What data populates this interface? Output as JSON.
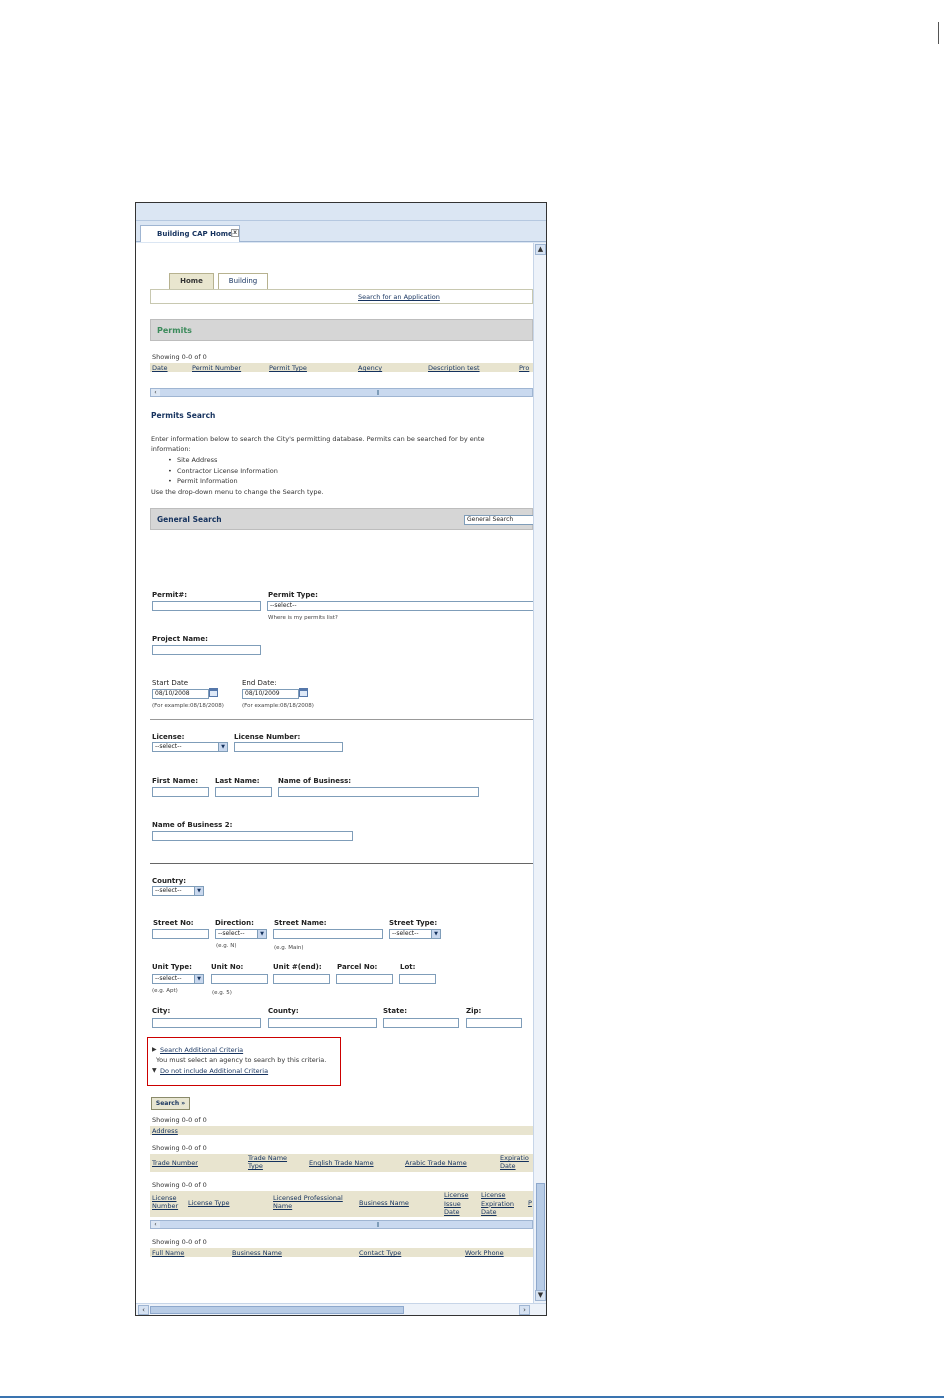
{
  "window": {
    "doc_tab_label": "Building CAP Home",
    "doc_tab_close": "x"
  },
  "module_tabs": [
    {
      "label": "Home"
    },
    {
      "label": "Building"
    }
  ],
  "subnav": {
    "search_link": "Search for an Application"
  },
  "permits_section": {
    "title": "Permits",
    "showing": "Showing 0-0 of 0",
    "columns": [
      "Date",
      "Permit Number",
      "Permit Type",
      "Agency",
      "Description test",
      "Pro"
    ]
  },
  "permits_search": {
    "title": "Permits Search",
    "intro_line1": "Enter information below to search the City's permitting database. Permits can be searched for by ente",
    "intro_line2": "information:",
    "criteria": [
      "Site Address",
      "Contractor License Information",
      "Permit Information"
    ],
    "outro": "Use the drop-down menu to change the Search type."
  },
  "general_search": {
    "title": "General Search",
    "type_select": "General Search"
  },
  "form": {
    "permit_no_label": "Permit#:",
    "permit_no_value": "",
    "permit_type_label": "Permit Type:",
    "permit_type_value": "--select--",
    "permit_type_hint": "Where is my permits list?",
    "project_name_label": "Project Name:",
    "project_name_value": "",
    "start_date_label": "Start Date",
    "start_date_value": "08/10/2008",
    "start_date_hint": "(For example:08/18/2008)",
    "end_date_label": "End Date:",
    "end_date_value": "08/10/2009",
    "end_date_hint": "(For example:08/18/2008)",
    "license_label": "License:",
    "license_value": "--select--",
    "license_number_label": "License Number:",
    "first_name_label": "First Name:",
    "last_name_label": "Last Name:",
    "business_name_label": "Name of Business:",
    "business_name2_label": "Name of Business 2:",
    "country_label": "Country:",
    "country_value": "--select--",
    "street_no_label": "Street No:",
    "direction_label": "Direction:",
    "direction_value": "--select--",
    "direction_hint": "(e.g. N)",
    "street_name_label": "Street Name:",
    "street_name_hint": "(e.g. Main)",
    "street_type_label": "Street Type:",
    "street_type_value": "--select--",
    "unit_type_label": "Unit Type:",
    "unit_type_value": "--select--",
    "unit_type_hint": "(e.g. Apt)",
    "unit_no_label": "Unit No:",
    "unit_no_hint": "(e.g. 5)",
    "unit_end_label": "Unit #(end):",
    "parcel_no_label": "Parcel No:",
    "lot_label": "Lot:",
    "city_label": "City:",
    "county_label": "County:",
    "state_label": "State:",
    "zip_label": "Zip:"
  },
  "additional": {
    "search_link": "Search Additional Criteria",
    "note": "You must select an agency to search by this criteria.",
    "exclude_link": "Do not include Additional Criteria"
  },
  "search_button": "Search »",
  "results": {
    "address": {
      "showing": "Showing 0-0 of 0",
      "columns": [
        "Address"
      ]
    },
    "trade": {
      "showing": "Showing 0-0 of 0",
      "columns": [
        "Trade Number",
        "Trade Name Type",
        "English Trade Name",
        "Arabic Trade Name",
        "Expiratio Date"
      ]
    },
    "license": {
      "showing": "Showing 0-0 of 0",
      "columns": [
        "License Number",
        "License Type",
        "Licensed Professional Name",
        "Business Name",
        "License Issue Date",
        "License Expiration Date",
        "P"
      ]
    },
    "contacts": {
      "showing": "Showing 0-0 of 0",
      "columns": [
        "Full Name",
        "Business Name",
        "Contact Type",
        "Work Phone"
      ]
    }
  },
  "colors": {
    "accent_green": "#3a8a5a",
    "navy": "#15325e",
    "section_gray": "#d6d6d6",
    "header_row": "#e8e4cf",
    "highlight_red": "#cc0000"
  }
}
